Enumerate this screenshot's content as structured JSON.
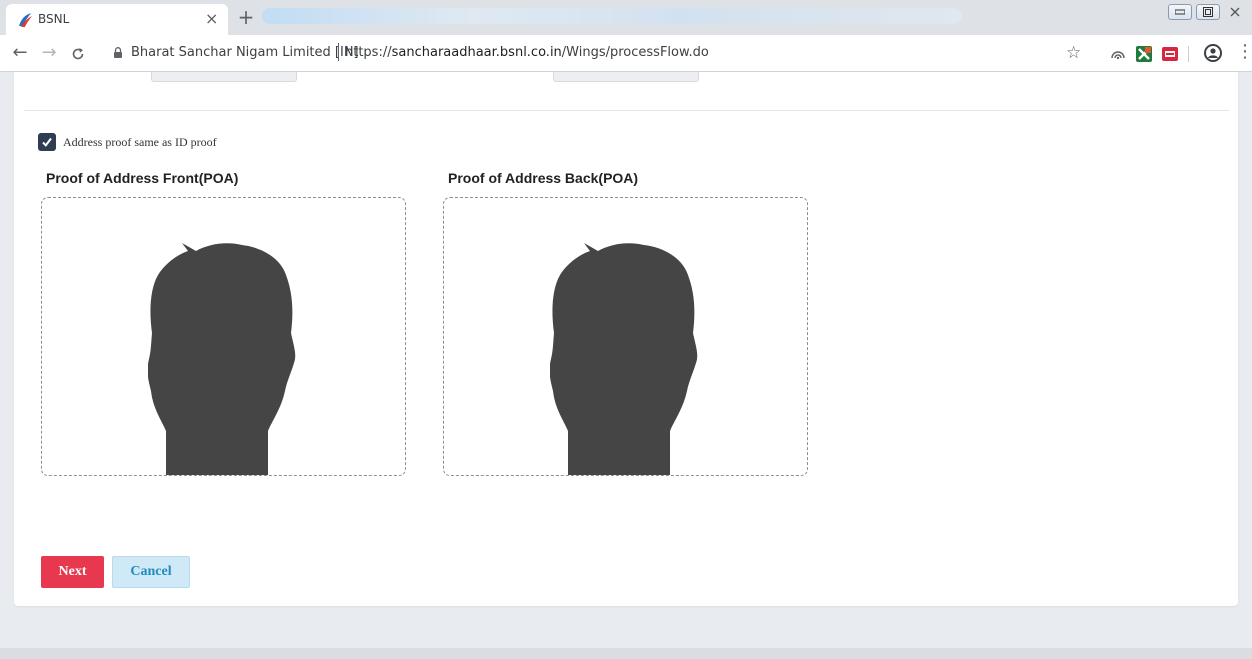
{
  "browser": {
    "tab_title": "BSNL",
    "tab_close": "×",
    "new_tab": "+",
    "window_controls": [
      "minimize",
      "maximize",
      "close"
    ],
    "site_name": "Bharat Sanchar Nigam Limited [IN]",
    "url_prefix": "https://",
    "url_domain": "sancharaadhaar.bsnl.co.in",
    "url_path": "/Wings/processFlow.do",
    "icons": {
      "back": "arrow-left-icon",
      "forward": "arrow-right-icon",
      "reload": "reload-icon",
      "lock": "lock-icon",
      "bookmark": "star-icon",
      "profile": "profile-icon",
      "menu": "kebab-menu-icon"
    }
  },
  "form": {
    "same_address_checkbox": {
      "label": "Address proof same as ID proof",
      "checked": true
    },
    "uploads": [
      {
        "title": "Proof of Address Front(POA)",
        "placeholder_icon": "person-silhouette-icon"
      },
      {
        "title": "Proof of Address Back(POA)",
        "placeholder_icon": "person-silhouette-icon"
      }
    ],
    "buttons": {
      "next": "Next",
      "cancel": "Cancel"
    }
  },
  "colors": {
    "next_button": "#e8384f",
    "cancel_button_bg": "#cfe9f6",
    "cancel_button_text": "#1f8bbf",
    "checkbox": "#2f3c52",
    "silhouette": "#454545"
  }
}
